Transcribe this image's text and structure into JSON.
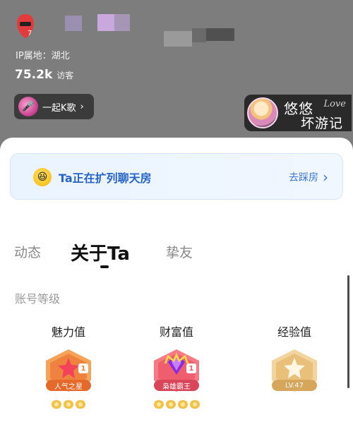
{
  "profile": {
    "ip_location": "IP属地：湖北",
    "visitor_count": "75.2k",
    "visitor_label": "访客"
  },
  "ksong_button": {
    "label": "一起K歌",
    "arrow": "›"
  },
  "room_card": {
    "title_line1": "悠悠",
    "title_line2": "坏游记",
    "decor_text": "Love"
  },
  "chat_banner": {
    "text": "Ta正在扩列聊天房",
    "action": "去踩房",
    "arrow": "›"
  },
  "tabs": [
    {
      "label": "动态",
      "active": false
    },
    {
      "label": "关于Ta",
      "active": true
    },
    {
      "label": "挚友",
      "active": false
    }
  ],
  "section": {
    "title": "账号等级"
  },
  "levels": [
    {
      "name": "魅力值",
      "badge_text": "人气之星",
      "level": "1",
      "color": "#f0823f",
      "medals": 3
    },
    {
      "name": "财富值",
      "badge_text": "枭雄霸王",
      "level": "1",
      "color": "#ef5e6f",
      "medals": 4
    },
    {
      "name": "经验值",
      "badge_text": "LV.47",
      "level": "",
      "color": "#e9c07a",
      "medals": 0
    }
  ],
  "colors": {
    "accent_blue": "#2664c9",
    "overlay_gray": "#7d7d7d"
  }
}
